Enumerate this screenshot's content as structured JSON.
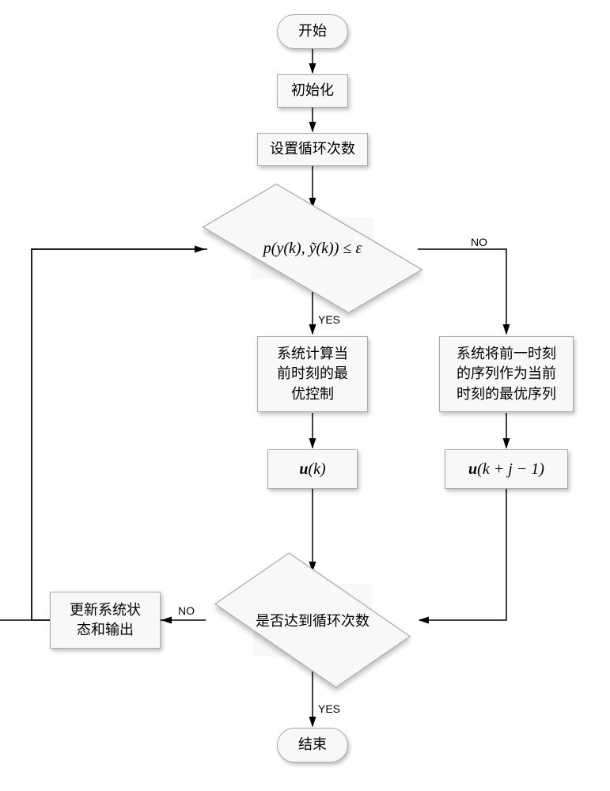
{
  "nodes": {
    "start": "开始",
    "init": "初始化",
    "set_loop": "设置循环次数",
    "decision1": "p(y(k), ỹ(k)) ≤ ε",
    "yes_compute": "系统计算当\n前时刻的最\n优控制",
    "no_previous": "系统将前一时刻\n的序列作为当前\n时刻的最优序列",
    "u_k": "u(k)",
    "u_kj": "u(k + j − 1)",
    "decision2": "是否达到循环次数",
    "update": "更新系统状\n态和输出",
    "end": "结束"
  },
  "labels": {
    "yes1": "YES",
    "no1": "NO",
    "yes2": "YES",
    "no2": "NO"
  }
}
